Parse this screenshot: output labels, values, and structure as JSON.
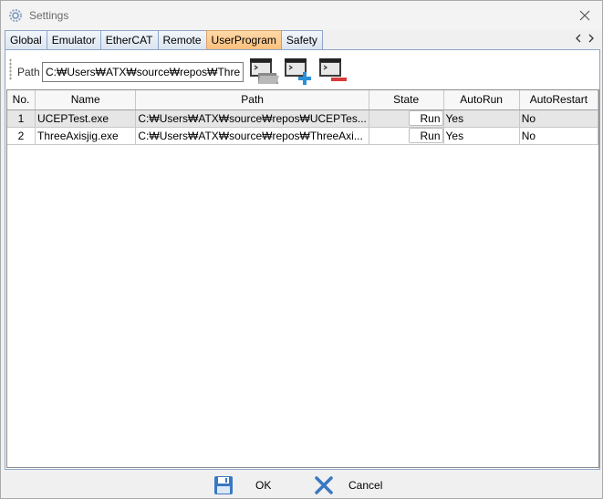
{
  "window": {
    "title": "Settings",
    "title_icon": "gear-icon",
    "close_icon": "close-icon"
  },
  "tabs": [
    {
      "label": "Global",
      "active": false
    },
    {
      "label": "Emulator",
      "active": false
    },
    {
      "label": "EtherCAT",
      "active": false
    },
    {
      "label": "Remote",
      "active": false
    },
    {
      "label": "UserProgram",
      "active": true
    },
    {
      "label": "Safety",
      "active": false
    }
  ],
  "toolbar": {
    "path_label": "Path",
    "path_value": "C:₩Users₩ATX₩source₩repos₩ThreeAxisJig",
    "buttons": [
      "browse-folder-icon",
      "add-program-icon",
      "remove-program-icon"
    ]
  },
  "table": {
    "columns": [
      "No.",
      "Name",
      "Path",
      "State",
      "AutoRun",
      "AutoRestart"
    ],
    "rows": [
      {
        "no": "1",
        "name": "UCEPTest.exe",
        "path": "C:₩Users₩ATX₩source₩repos₩UCEPTes...",
        "state": "Run",
        "autorun": "Yes",
        "autorestart": "No",
        "selected": true
      },
      {
        "no": "2",
        "name": "ThreeAxisjig.exe",
        "path": "C:₩Users₩ATX₩source₩repos₩ThreeAxi...",
        "state": "Run",
        "autorun": "Yes",
        "autorestart": "No",
        "selected": false
      }
    ]
  },
  "footer": {
    "ok_label": "OK",
    "cancel_label": "Cancel"
  },
  "colors": {
    "active_tab": "#fcc07c",
    "tab_border": "#8fa6c8",
    "ok_icon": "#3a78c2",
    "cancel_icon": "#3a78c2"
  }
}
